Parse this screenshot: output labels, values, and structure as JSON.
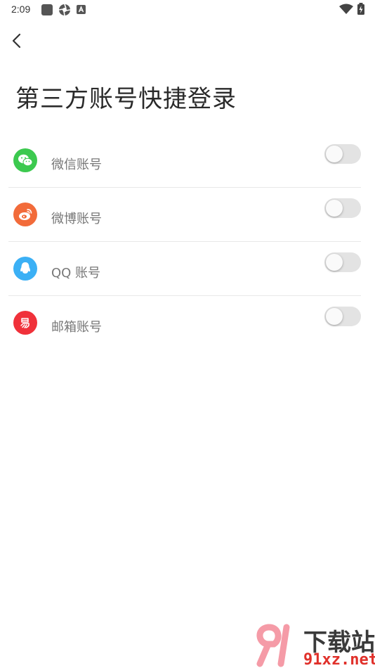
{
  "status_bar": {
    "time": "2:09"
  },
  "header": {
    "title": "第三方账号快捷登录"
  },
  "accounts": [
    {
      "label": "微信账号",
      "icon": "wechat-icon",
      "color": "#3cc94f",
      "enabled": false
    },
    {
      "label": "微博账号",
      "icon": "weibo-icon",
      "color": "#f26b3a",
      "enabled": false
    },
    {
      "label": "QQ 账号",
      "icon": "qq-icon",
      "color": "#3bb0f5",
      "enabled": false
    },
    {
      "label": "邮箱账号",
      "icon": "mail-icon",
      "color": "#f0313a",
      "enabled": false
    }
  ],
  "watermark": {
    "top": "下载站",
    "bottom": "91xz.net"
  }
}
